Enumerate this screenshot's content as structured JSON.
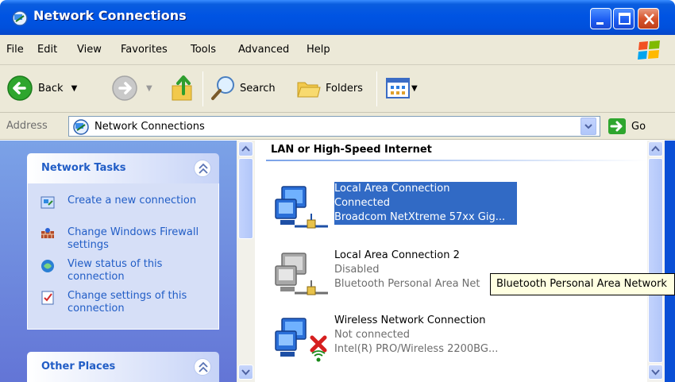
{
  "window": {
    "title": "Network Connections",
    "buttons": [
      "minimize",
      "maximize",
      "close"
    ]
  },
  "menu": {
    "items": [
      "File",
      "Edit",
      "View",
      "Favorites",
      "Tools",
      "Advanced",
      "Help"
    ]
  },
  "toolbar": {
    "back_label": "Back",
    "search_label": "Search",
    "folders_label": "Folders"
  },
  "address": {
    "label": "Address",
    "value": "Network Connections",
    "go_label": "Go"
  },
  "tasks": {
    "network_tasks_title": "Network Tasks",
    "links": [
      {
        "label": "Create a new connection",
        "icon": "new-connection-icon"
      },
      {
        "label": "Change Windows Firewall settings",
        "icon": "firewall-icon"
      },
      {
        "label": "View status of this connection",
        "icon": "status-icon"
      },
      {
        "label": "Change settings of this connection",
        "icon": "settings-icon"
      }
    ],
    "other_places_title": "Other Places"
  },
  "content": {
    "group_title": "LAN or High-Speed Internet",
    "connections": [
      {
        "name": "Local Area Connection",
        "status": "Connected",
        "device": "Broadcom NetXtreme 57xx Gig..."
      },
      {
        "name": "Local Area Connection 2",
        "status": "Disabled",
        "device": "Bluetooth Personal Area Net"
      },
      {
        "name": "Wireless Network Connection",
        "status": "Not connected",
        "device": "Intel(R) PRO/Wireless 2200BG..."
      }
    ]
  },
  "tooltip": {
    "text": "Bluetooth Personal Area Network"
  },
  "colors": {
    "titlebar": "#0054e3",
    "selection": "#316ac5",
    "task_link": "#215dc6",
    "panel": "#6d89dd"
  }
}
